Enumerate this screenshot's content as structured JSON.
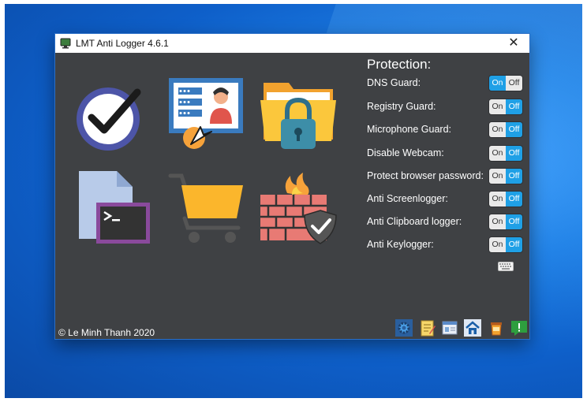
{
  "window": {
    "title": "LMT Anti Logger 4.6.1",
    "close_glyph": "✕"
  },
  "protection": {
    "heading": "Protection:",
    "options": [
      {
        "label": "DNS Guard:",
        "state": "on"
      },
      {
        "label": "Registry Guard:",
        "state": "off"
      },
      {
        "label": "Microphone Guard:",
        "state": "off"
      },
      {
        "label": "Disable Webcam:",
        "state": "off"
      },
      {
        "label": "Protect browser password:",
        "state": "off"
      },
      {
        "label": "Anti Screenlogger:",
        "state": "off"
      },
      {
        "label": "Anti Clipboard logger:",
        "state": "off"
      },
      {
        "label": "Anti Keylogger:",
        "state": "off"
      }
    ],
    "on_label": "On",
    "off_label": "Off"
  },
  "tiles": [
    "clock-check-icon",
    "user-panel-icon",
    "folder-lock-icon",
    "terminal-file-icon",
    "shopping-cart-icon",
    "firewall-icon"
  ],
  "footer": {
    "copyright": "© Le Minh Thanh 2020"
  },
  "toolbar": [
    "settings-icon",
    "notes-icon",
    "id-card-icon",
    "home-icon",
    "trash-icon",
    "message-alert-icon"
  ],
  "colors": {
    "window_bg": "#3f4144",
    "toggle_active": "#1fa0e6",
    "toggle_inactive": "#e9e9e9"
  }
}
